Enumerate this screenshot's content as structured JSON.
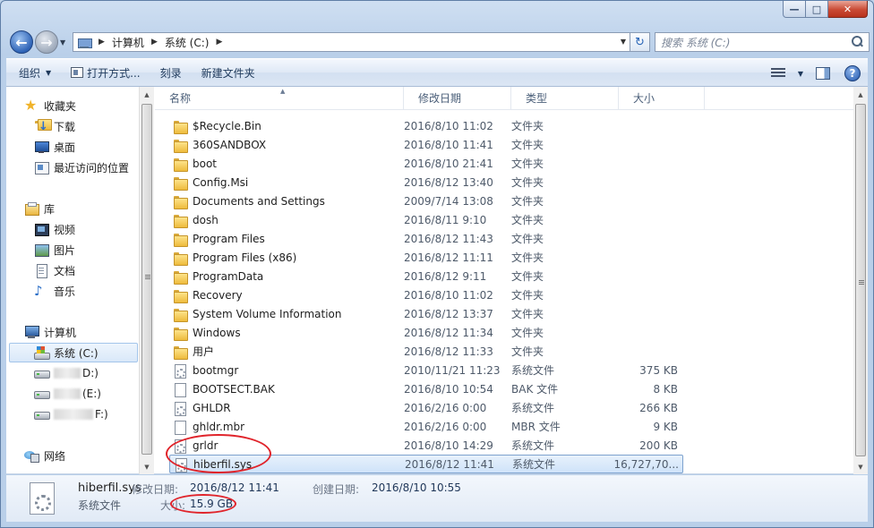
{
  "window": {
    "caption": {
      "minimize": "—",
      "maximize": "□",
      "close": "✕"
    }
  },
  "address_bar": {
    "crumbs": [
      "计算机",
      "系统 (C:)"
    ],
    "refresh_glyph": "↻"
  },
  "search": {
    "placeholder": "搜索 系统 (C:)"
  },
  "toolbar": {
    "organize": "组织",
    "open_with": "打开方式...",
    "burn": "刻录",
    "new_folder": "新建文件夹",
    "help": "?"
  },
  "nav_pane": {
    "favorites": "收藏夹",
    "downloads": "下载",
    "desktop": "桌面",
    "recent": "最近访问的位置",
    "libraries": "库",
    "videos": "视频",
    "pictures": "图片",
    "documents": "文档",
    "music": "音乐",
    "computer": "计算机",
    "drive_c": "系统 (C:)",
    "drive_d": "D:)",
    "drive_e": "(E:)",
    "drive_f": "F:)",
    "network": "网络"
  },
  "columns": {
    "name": "名称",
    "modified": "修改日期",
    "type": "类型",
    "size": "大小"
  },
  "files": [
    {
      "name": "$Recycle.Bin",
      "date": "2016/8/10 11:02",
      "type": "文件夹",
      "size": "",
      "kind": "folder"
    },
    {
      "name": "360SANDBOX",
      "date": "2016/8/10 11:41",
      "type": "文件夹",
      "size": "",
      "kind": "folder"
    },
    {
      "name": "boot",
      "date": "2016/8/10 21:41",
      "type": "文件夹",
      "size": "",
      "kind": "folder"
    },
    {
      "name": "Config.Msi",
      "date": "2016/8/12 13:40",
      "type": "文件夹",
      "size": "",
      "kind": "folder"
    },
    {
      "name": "Documents and Settings",
      "date": "2009/7/14 13:08",
      "type": "文件夹",
      "size": "",
      "kind": "folder"
    },
    {
      "name": "dosh",
      "date": "2016/8/11 9:10",
      "type": "文件夹",
      "size": "",
      "kind": "folder"
    },
    {
      "name": "Program Files",
      "date": "2016/8/12 11:43",
      "type": "文件夹",
      "size": "",
      "kind": "folder"
    },
    {
      "name": "Program Files (x86)",
      "date": "2016/8/12 11:11",
      "type": "文件夹",
      "size": "",
      "kind": "folder"
    },
    {
      "name": "ProgramData",
      "date": "2016/8/12 9:11",
      "type": "文件夹",
      "size": "",
      "kind": "folder"
    },
    {
      "name": "Recovery",
      "date": "2016/8/10 11:02",
      "type": "文件夹",
      "size": "",
      "kind": "folder"
    },
    {
      "name": "System Volume Information",
      "date": "2016/8/12 13:37",
      "type": "文件夹",
      "size": "",
      "kind": "folder"
    },
    {
      "name": "Windows",
      "date": "2016/8/12 11:34",
      "type": "文件夹",
      "size": "",
      "kind": "folder"
    },
    {
      "name": "用户",
      "date": "2016/8/12 11:33",
      "type": "文件夹",
      "size": "",
      "kind": "folder"
    },
    {
      "name": "bootmgr",
      "date": "2010/11/21 11:23",
      "type": "系统文件",
      "size": "375 KB",
      "kind": "sysfile"
    },
    {
      "name": "BOOTSECT.BAK",
      "date": "2016/8/10 10:54",
      "type": "BAK 文件",
      "size": "8 KB",
      "kind": "file"
    },
    {
      "name": "GHLDR",
      "date": "2016/2/16 0:00",
      "type": "系统文件",
      "size": "266 KB",
      "kind": "sysfile"
    },
    {
      "name": "ghldr.mbr",
      "date": "2016/2/16 0:00",
      "type": "MBR 文件",
      "size": "9 KB",
      "kind": "file"
    },
    {
      "name": "grldr",
      "date": "2016/8/10 14:29",
      "type": "系统文件",
      "size": "200 KB",
      "kind": "sysfile"
    },
    {
      "name": "hiberfil.sys",
      "date": "2016/8/12 11:41",
      "type": "系统文件",
      "size": "16,727,70...",
      "kind": "sysfile",
      "selected": true
    }
  ],
  "details": {
    "name": "hiberfil.sys",
    "type": "系统文件",
    "modified_label": "修改日期:",
    "modified_value": "2016/8/12 11:41",
    "created_label": "创建日期:",
    "created_value": "2016/8/10 10:55",
    "size_label": "大小:",
    "size_value": "15.9 GB"
  },
  "colors": {
    "annotation": "#e0242b",
    "selection": "#cfe3f9"
  }
}
